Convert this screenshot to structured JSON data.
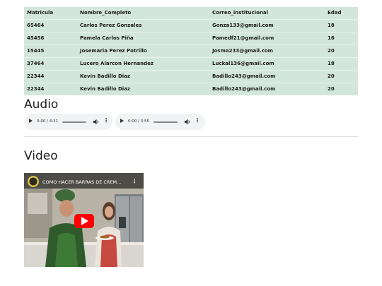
{
  "table": {
    "headers": [
      "Matricula",
      "Nombre_Completo",
      "Correo_institucional",
      "Edad"
    ],
    "rows": [
      [
        "65464",
        "Carlos Perez Gonzales",
        "Gonza133@gmail.com",
        "18"
      ],
      [
        "45456",
        "Pamela Carlos Piña",
        "Pamedf21@gmail.com",
        "16"
      ],
      [
        "15445",
        "Josemaria Perez Potrillo",
        "Josma233@gmail.com",
        "20"
      ],
      [
        "37464",
        "Lucero Alarcon Hernandez",
        "Luckal136@gmail.com",
        "18"
      ],
      [
        "22344",
        "Kevin Badillo Diaz",
        "Badillo243@gmail.com",
        "20"
      ],
      [
        "22344",
        "Kevin Badillo Diaz",
        "Badillo243@gmail.com",
        "20"
      ]
    ]
  },
  "audio": {
    "title": "Audio",
    "players": [
      {
        "time": "0:00 / 4:31"
      },
      {
        "time": "0:00 / 3:55"
      }
    ]
  },
  "video": {
    "title": "Video",
    "caption": "COMO HACER BARRAS DE CREM...",
    "menu_glyph": "⋮"
  },
  "colors": {
    "table_bg": "#d3e6dc",
    "youtube_red": "#ff0000",
    "player_bg": "#f1f3f4"
  }
}
